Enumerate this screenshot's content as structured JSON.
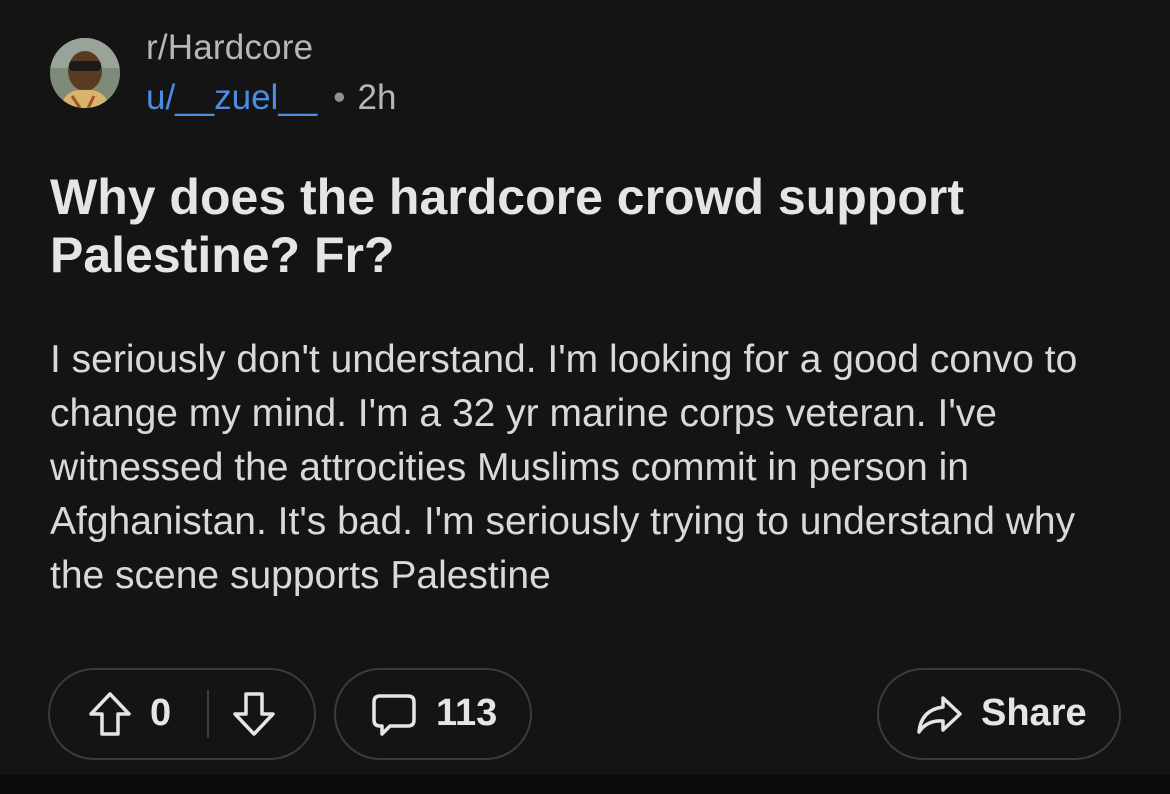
{
  "post": {
    "subreddit": "r/Hardcore",
    "username": "u/__zuel__",
    "separator": "•",
    "time": "2h",
    "title": "Why does the hardcore crowd support Palestine? Fr?",
    "body": "I seriously don't understand. I'm looking for a good convo to change my mind. I'm a 32 yr marine corps veteran. I've witnessed the attrocities Muslims commit in person in Afghanistan. It's bad. I'm seriously trying to understand why the scene supports Palestine"
  },
  "actions": {
    "score": "0",
    "comments": "113",
    "share_label": "Share"
  },
  "icons": {
    "upvote": "upvote-arrow-icon",
    "downvote": "downvote-arrow-icon",
    "comment": "comment-bubble-icon",
    "share": "share-arrow-icon"
  },
  "colors": {
    "background": "#141414",
    "username": "#4a8de3",
    "text": "#d7dadc",
    "pill_border": "#3a3c3d"
  }
}
